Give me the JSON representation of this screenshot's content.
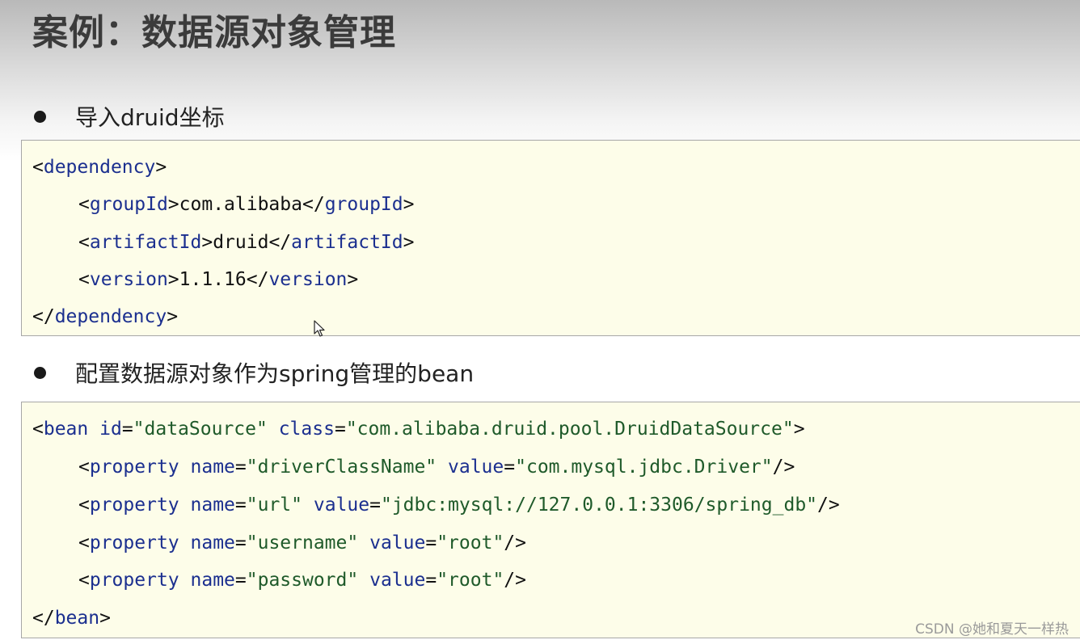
{
  "slide": {
    "title": "案例：数据源对象管理",
    "bullets": [
      "导入druid坐标",
      "配置数据源对象作为spring管理的bean"
    ]
  },
  "code1": {
    "dependency_open": {
      "lt": "<",
      "tag": "dependency",
      "gt": ">"
    },
    "groupId": {
      "lt": "<",
      "tag": "groupId",
      "gt": ">",
      "text": "com.alibaba",
      "clt": "</",
      "ctag": "groupId",
      "cgt": ">"
    },
    "artifactId": {
      "lt": "<",
      "tag": "artifactId",
      "gt": ">",
      "text": "druid",
      "clt": "</",
      "ctag": "artifactId",
      "cgt": ">"
    },
    "version": {
      "lt": "<",
      "tag": "version",
      "gt": ">",
      "text": "1.1.16",
      "clt": "</",
      "ctag": "version",
      "cgt": ">"
    },
    "dependency_close": {
      "lt": "</",
      "tag": "dependency",
      "gt": ">"
    }
  },
  "code2": {
    "bean_open": {
      "lt": "<",
      "tag": "bean",
      "a1": "id",
      "eq1": "=",
      "v1": "\"dataSource\"",
      "a2": "class",
      "eq2": "=",
      "v2": "\"com.alibaba.druid.pool.DruidDataSource\"",
      "gt": ">"
    },
    "props": [
      {
        "lt": "<",
        "tag": "property",
        "a1": "name",
        "eq1": "=",
        "v1": "\"driverClassName\"",
        "a2": "value",
        "eq2": "=",
        "v2": "\"com.mysql.jdbc.Driver\"",
        "end": "/>"
      },
      {
        "lt": "<",
        "tag": "property",
        "a1": "name",
        "eq1": "=",
        "v1": "\"url\"",
        "a2": "value",
        "eq2": "=",
        "v2": "\"jdbc:mysql://127.0.0.1:3306/spring_db\"",
        "end": "/>"
      },
      {
        "lt": "<",
        "tag": "property",
        "a1": "name",
        "eq1": "=",
        "v1": "\"username\"",
        "a2": "value",
        "eq2": "=",
        "v2": "\"root\"",
        "end": "/>"
      },
      {
        "lt": "<",
        "tag": "property",
        "a1": "name",
        "eq1": "=",
        "v1": "\"password\"",
        "a2": "value",
        "eq2": "=",
        "v2": "\"root\"",
        "end": "/>"
      }
    ],
    "bean_close": {
      "lt": "</",
      "tag": "bean",
      "gt": ">"
    }
  },
  "watermark": "CSDN @她和夏天一样热",
  "colors": {
    "tag": "#1b2f8f",
    "string": "#1f5a2a",
    "code_bg": "#fdfde9"
  },
  "icons": {
    "bullet": "bullet-dot",
    "cursor": "mouse-pointer-icon"
  }
}
